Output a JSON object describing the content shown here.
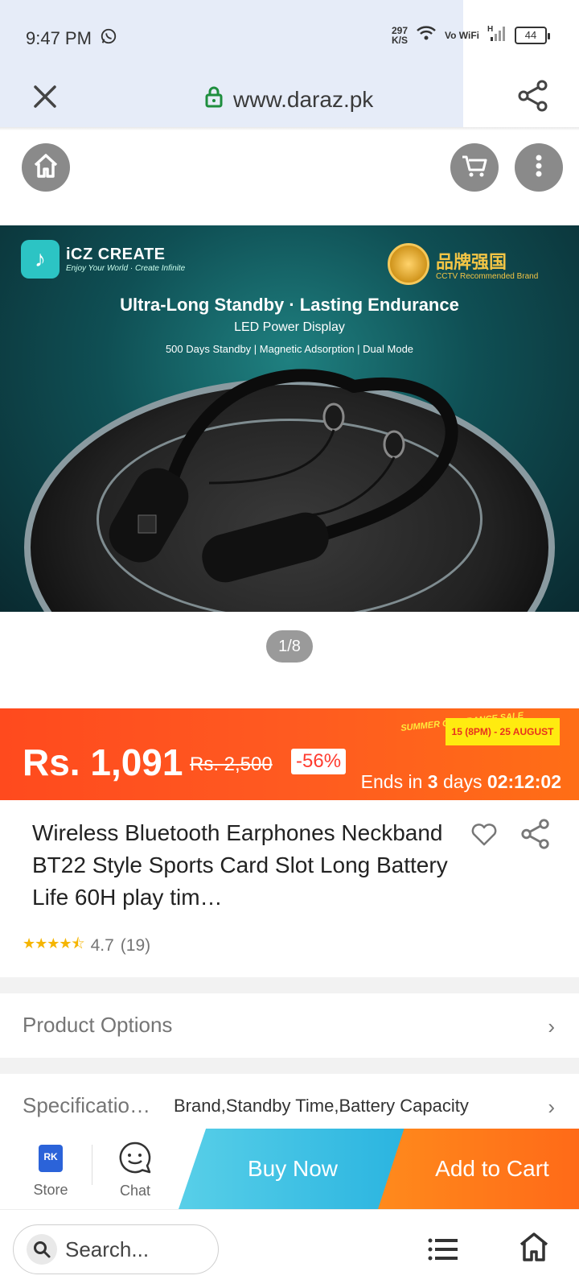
{
  "status_bar": {
    "time": "9:47 PM",
    "net_speed_value": "297",
    "net_speed_unit": "K/S",
    "volte": "Vo WiFi",
    "signal_type": "H",
    "battery": "44"
  },
  "url_bar": {
    "url": "www.daraz.pk"
  },
  "banner": {
    "brand_name": "iCZ CREATE",
    "brand_tagline": "Enjoy Your World · Create Infinite",
    "seal_text": "品牌强国",
    "seal_subtext": "CCTV Recommended Brand",
    "headline": "Ultra-Long Standby · Lasting Endurance",
    "subheadline": "LED Power Display",
    "features": "500 Days Standby | Magnetic Adsorption | Dual Mode",
    "pager": "1/8"
  },
  "promo": {
    "price": "Rs. 1,091",
    "old_price": "Rs. 2,500",
    "discount": "-56%",
    "sale_tag": "SUMMER CLEARANCE SALE",
    "sale_dates": "15 (8PM) - 25 AUGUST",
    "ends_prefix": "Ends in",
    "ends_days": "3",
    "ends_days_unit": "days",
    "ends_time": "02:12:02"
  },
  "product": {
    "title": "Wireless Bluetooth Earphones Neckband BT22 Style Sports Card Slot Long Battery Life 60H play tim…",
    "rating_value": "4.7",
    "rating_count": "(19)",
    "rating_stars": 4.5
  },
  "rows": {
    "options_label": "Product Options",
    "spec_label": "Specificatio…",
    "spec_value": "Brand,Standby Time,Battery Capacity"
  },
  "action_bar": {
    "store_label": "Store",
    "store_logo_text": "RK",
    "chat_label": "Chat",
    "buy_now": "Buy Now",
    "add_to_cart": "Add to Cart"
  },
  "bottom_nav": {
    "search_placeholder": "Search..."
  }
}
